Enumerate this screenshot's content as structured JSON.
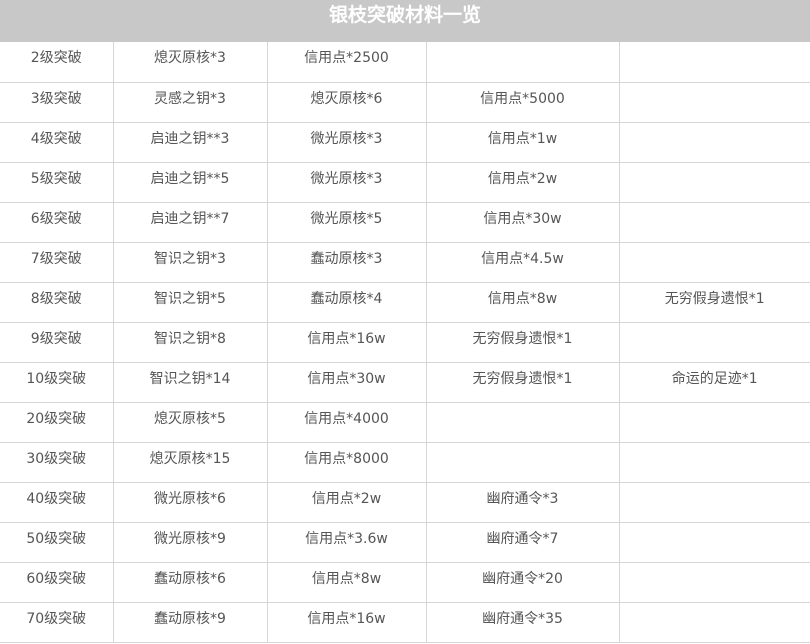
{
  "title": "银枝突破材料一览",
  "rows": [
    [
      "2级突破",
      "熄灭原核*3",
      "信用点*2500",
      "",
      ""
    ],
    [
      "3级突破",
      "灵感之钥*3",
      "熄灭原核*6",
      "信用点*5000",
      ""
    ],
    [
      "4级突破",
      "启迪之钥**3",
      "微光原核*3",
      "信用点*1w",
      ""
    ],
    [
      "5级突破",
      "启迪之钥**5",
      "微光原核*3",
      "信用点*2w",
      ""
    ],
    [
      "6级突破",
      "启迪之钥**7",
      "微光原核*5",
      "信用点*30w",
      ""
    ],
    [
      "7级突破",
      "智识之钥*3",
      "蠢动原核*3",
      "信用点*4.5w",
      ""
    ],
    [
      "8级突破",
      "智识之钥*5",
      "蠢动原核*4",
      "信用点*8w",
      "无穷假身遗恨*1"
    ],
    [
      "9级突破",
      "智识之钥*8",
      "信用点*16w",
      "无穷假身遗恨*1",
      ""
    ],
    [
      "10级突破",
      "智识之钥*14",
      "信用点*30w",
      "无穷假身遗恨*1",
      "命运的足迹*1"
    ],
    [
      "20级突破",
      "熄灭原核*5",
      "信用点*4000",
      "",
      ""
    ],
    [
      "30级突破",
      "熄灭原核*15",
      "信用点*8000",
      "",
      ""
    ],
    [
      "40级突破",
      "微光原核*6",
      "信用点*2w",
      "幽府通令*3",
      ""
    ],
    [
      "50级突破",
      "微光原核*9",
      "信用点*3.6w",
      "幽府通令*7",
      ""
    ],
    [
      "60级突破",
      "蠢动原核*6",
      "信用点*8w",
      "幽府通令*20",
      ""
    ],
    [
      "70级突破",
      "蠢动原核*9",
      "信用点*16w",
      "幽府通令*35",
      ""
    ]
  ],
  "colors": {
    "title_bg": "#c8c8c8",
    "title_text": "#ffffff",
    "cell_text": "#555555",
    "grid": "#d6d6d6"
  }
}
